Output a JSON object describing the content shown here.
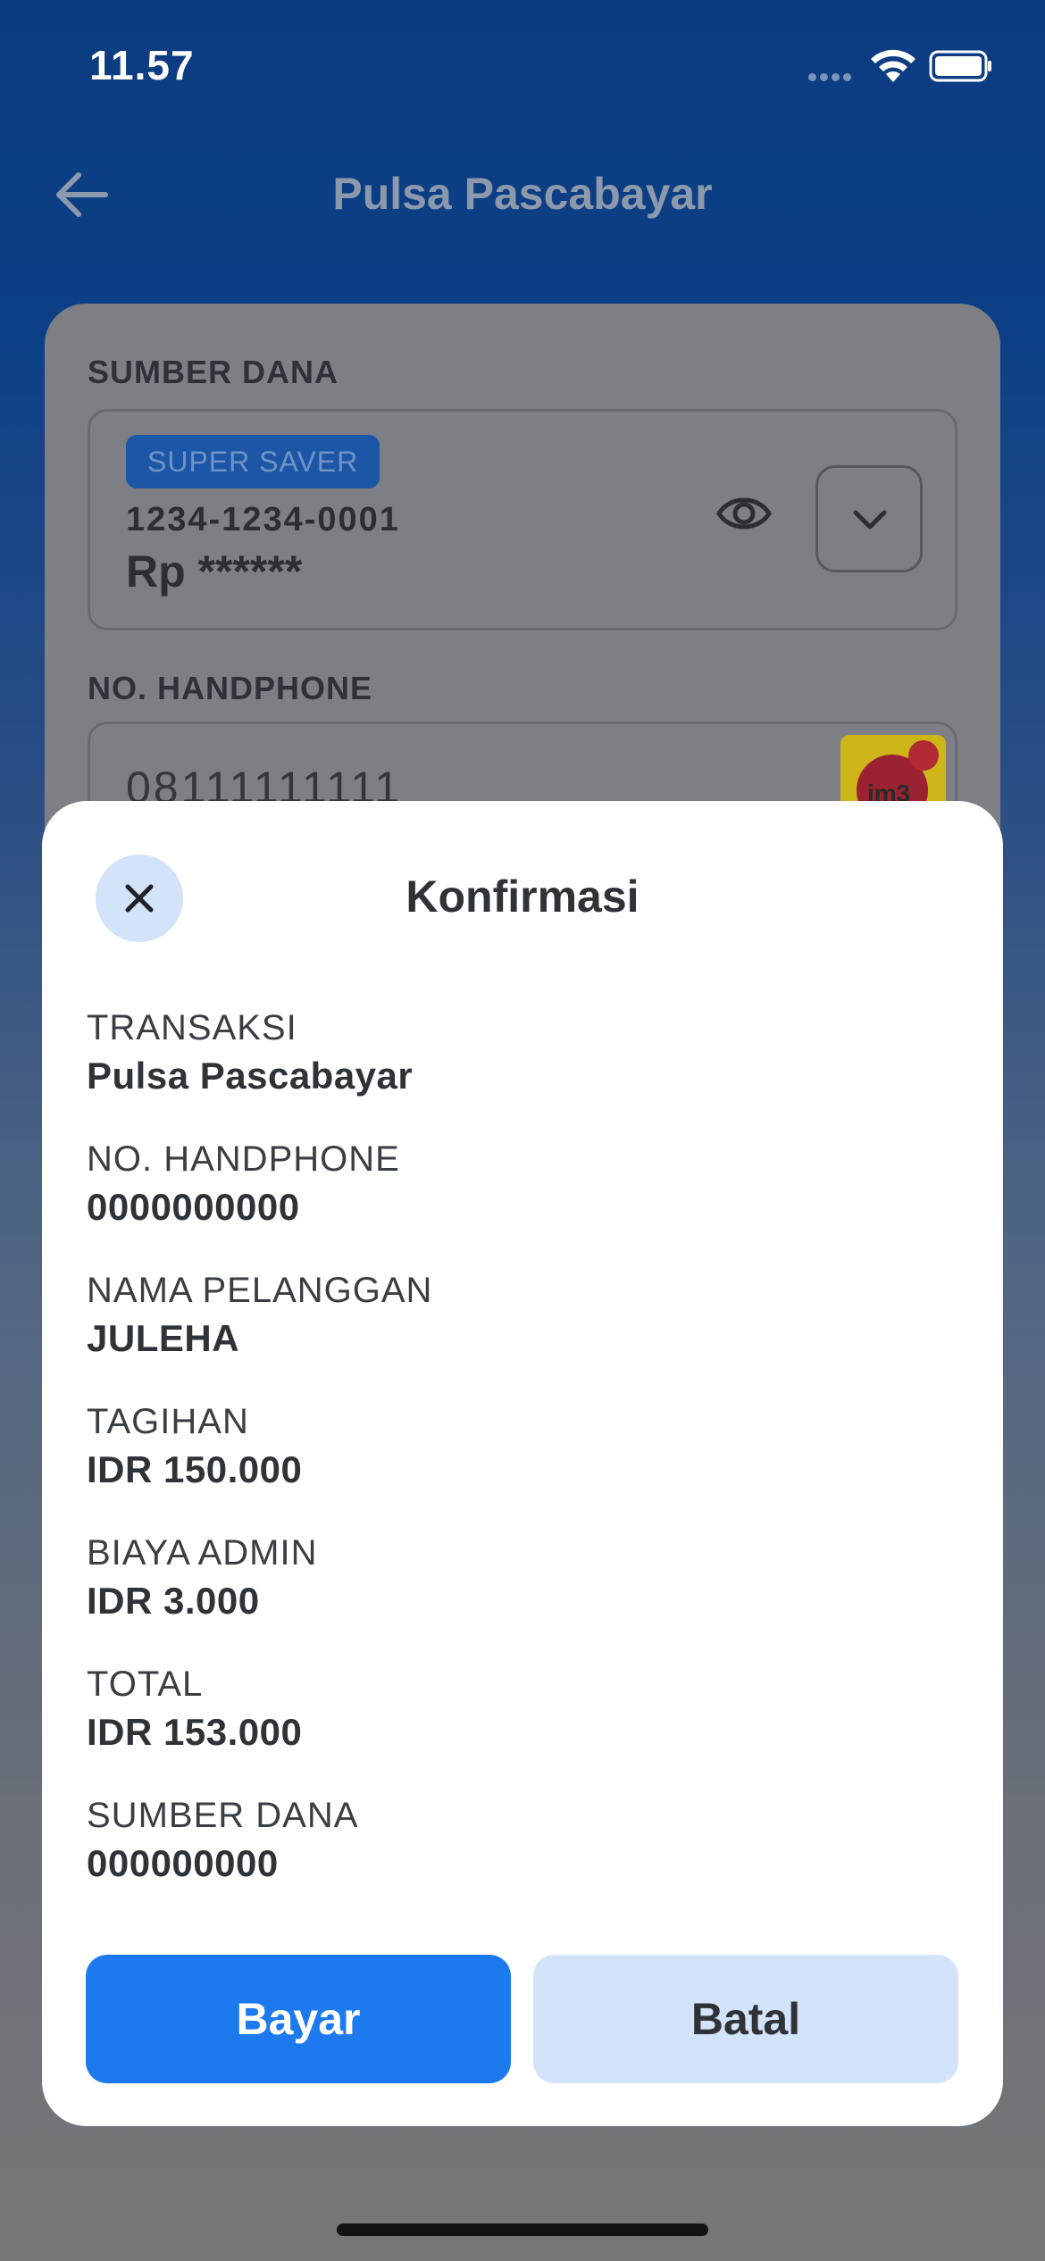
{
  "status_bar": {
    "time": "11.57"
  },
  "header": {
    "title": "Pulsa Pascabayar"
  },
  "background_form": {
    "source_label": "SUMBER DANA",
    "badge": "SUPER SAVER",
    "account_number": "1234-1234-0001",
    "balance": "Rp ******",
    "phone_label": "NO. HANDPHONE",
    "phone_value": "08111111111",
    "operator_logo_text": "im3"
  },
  "modal": {
    "title": "Konfirmasi",
    "details": [
      {
        "label": "TRANSAKSI",
        "value": "Pulsa Pascabayar"
      },
      {
        "label": "NO. HANDPHONE",
        "value": "0000000000"
      },
      {
        "label": "NAMA PELANGGAN",
        "value": "JULEHA"
      },
      {
        "label": "TAGIHAN",
        "value": "IDR 150.000"
      },
      {
        "label": "BIAYA ADMIN",
        "value": "IDR 3.000"
      },
      {
        "label": "TOTAL",
        "value": "IDR 153.000"
      },
      {
        "label": "SUMBER DANA",
        "value": "000000000"
      }
    ],
    "pay_label": "Bayar",
    "cancel_label": "Batal"
  },
  "colors": {
    "primary": "#1c7aee",
    "secondary_button": "#d3e3f9",
    "header_bg": "#0c3c80"
  }
}
